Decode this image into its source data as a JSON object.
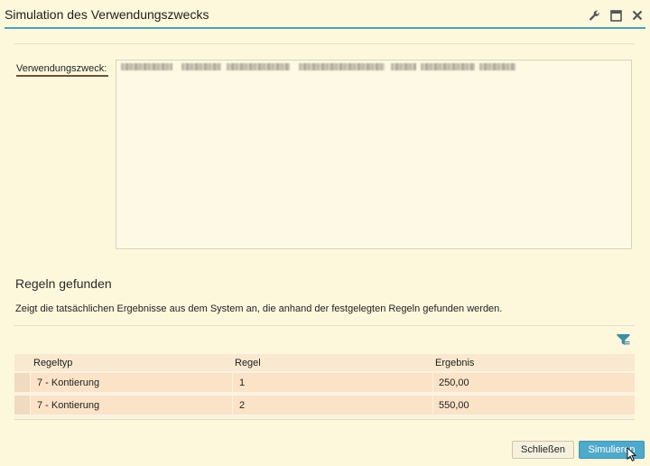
{
  "window": {
    "title": "Simulation des Verwendungszwecks"
  },
  "icons": {
    "settings": "wrench-icon",
    "maximize": "maximize-icon",
    "close": "close-icon",
    "filter": "filter-icon"
  },
  "purpose": {
    "label": "Verwendungszweck:"
  },
  "rules": {
    "heading": "Regeln gefunden",
    "description": "Zeigt die tatsächlichen Ergebnisse aus dem System an, die anhand der festgelegten Regeln gefunden werden.",
    "columns": [
      "Regeltyp",
      "Regel",
      "Ergebnis"
    ],
    "rows": [
      [
        "7 - Kontierung",
        "1",
        "250,00"
      ],
      [
        "7 - Kontierung",
        "2",
        "550,00"
      ]
    ]
  },
  "buttons": {
    "close": "Schließen",
    "simulate": "Simulieren"
  },
  "colors": {
    "background": "#fdf8dc",
    "accent": "#4aa3b8",
    "primary_button": "#4fa9c9",
    "header_fill": "#f8e9d0",
    "row_fill": "#fbe3c8"
  }
}
